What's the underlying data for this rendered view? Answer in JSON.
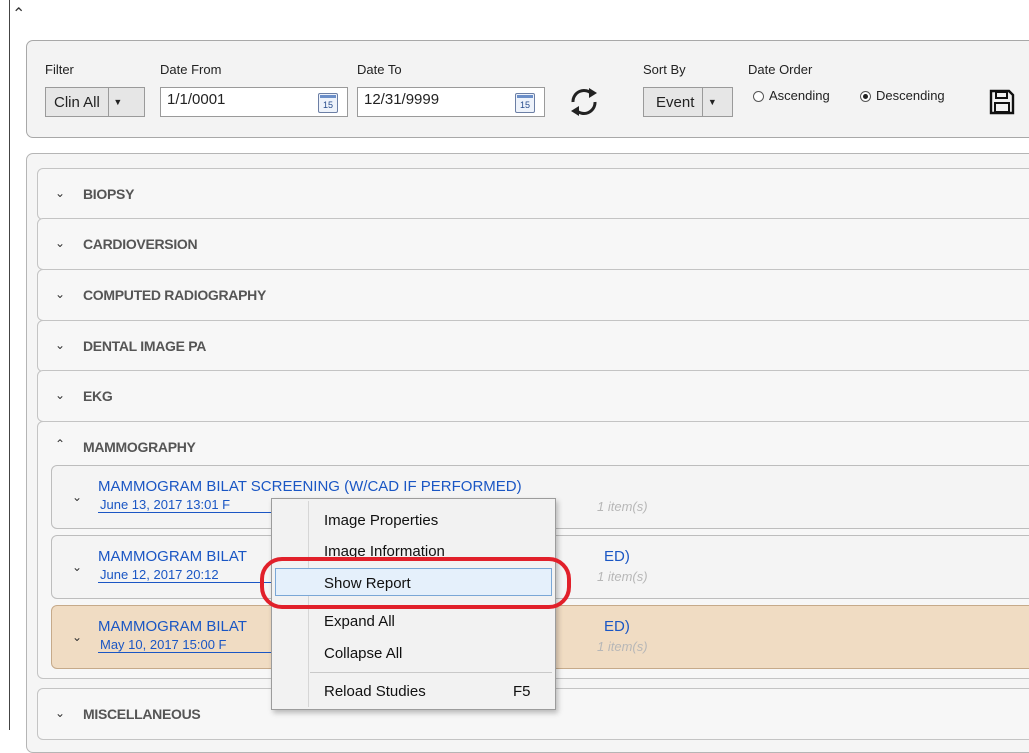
{
  "filters": {
    "filter_label": "Filter",
    "filter_value": "Clin All",
    "date_from_label": "Date From",
    "date_from_value": "1/1/0001",
    "date_to_label": "Date To",
    "date_to_value": "12/31/9999",
    "calendar_day": "15",
    "sort_by_label": "Sort By",
    "sort_by_value": "Event",
    "date_order_label": "Date Order",
    "ascending_label": "Ascending",
    "descending_label": "Descending",
    "date_order_selected": "Descending"
  },
  "groups": [
    {
      "name": "BIOPSY",
      "expanded": false
    },
    {
      "name": "CARDIOVERSION",
      "expanded": false
    },
    {
      "name": "COMPUTED RADIOGRAPHY",
      "expanded": false
    },
    {
      "name": "DENTAL IMAGE PA",
      "expanded": false
    },
    {
      "name": "EKG",
      "expanded": false
    },
    {
      "name": "MAMMOGRAPHY",
      "expanded": true
    },
    {
      "name": "MISCELLANEOUS",
      "expanded": false
    }
  ],
  "mammography_items": [
    {
      "title": "MAMMOGRAM BILAT SCREENING (W/CAD IF PERFORMED)",
      "date": "June 13, 2017 13:01 F",
      "count": "1 item(s)"
    },
    {
      "title": "MAMMOGRAM BILAT",
      "title_tail": "ED)",
      "date": "June 12, 2017 20:12",
      "count": "1 item(s)"
    },
    {
      "title": "MAMMOGRAM BILAT",
      "title_tail": "ED)",
      "date": "May 10, 2017 15:00 F",
      "count": "1 item(s)",
      "selected": true
    }
  ],
  "context_menu": {
    "items": [
      {
        "label": "Image Properties"
      },
      {
        "label": "Image Information"
      },
      {
        "label": "Show Report",
        "highlighted": true
      },
      {
        "label": "Expand All"
      },
      {
        "label": "Collapse All"
      },
      {
        "label": "Reload Studies",
        "shortcut": "F5"
      }
    ]
  },
  "colors": {
    "accent_link": "#1a56c4",
    "selected_row": "#f0dcc3",
    "annotation_ring": "#e1202a"
  },
  "icons": {
    "top": "chevron-up-icon",
    "refresh": "refresh-icon",
    "save": "floppy-disk-icon",
    "calendar": "calendar-icon"
  }
}
